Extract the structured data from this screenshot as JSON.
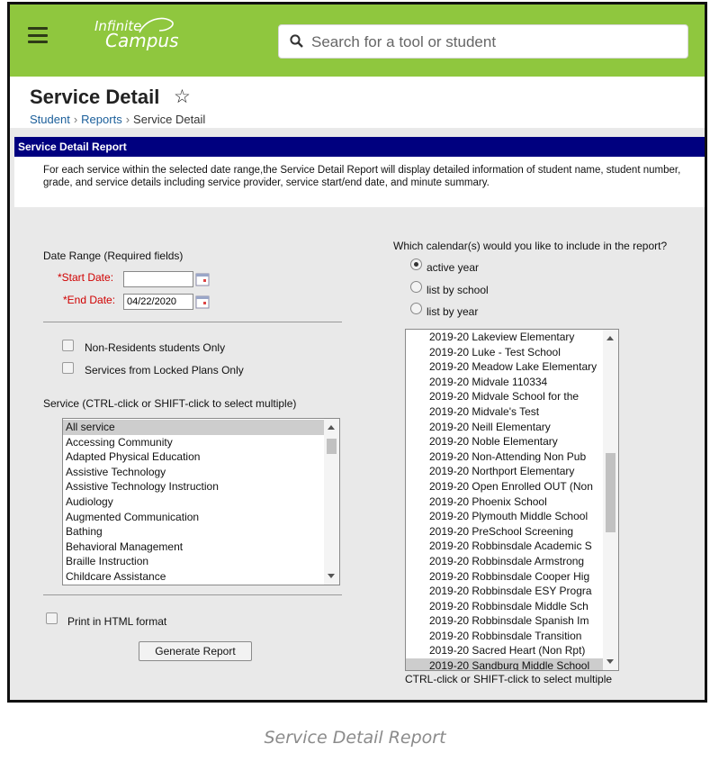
{
  "app": {
    "logo_line1": "Infinite",
    "logo_line2": "Campus"
  },
  "search": {
    "placeholder": "Search for a tool or student"
  },
  "page": {
    "title": "Service Detail"
  },
  "breadcrumb": [
    "Student",
    "Reports",
    "Service Detail"
  ],
  "report": {
    "title": "Service Detail Report",
    "description": "For each service within the selected date range,the Service Detail Report will display detailed information of student name, student number, grade, and service details including service provider, service start/end date, and minute summary."
  },
  "form": {
    "date_range_label": "Date Range (Required fields)",
    "start_date_label": "*Start Date:",
    "start_date_value": "",
    "end_date_label": "*End Date:",
    "end_date_value": "04/22/2020",
    "non_residents_label": "Non-Residents students Only",
    "locked_plans_label": "Services from Locked Plans Only",
    "service_label": "Service (CTRL-click or SHIFT-click to select multiple)",
    "services": [
      "All service",
      "Accessing Community",
      "Adapted Physical Education",
      "Assistive Technology",
      "Assistive Technology Instruction",
      "Audiology",
      "Augmented Communication",
      "Bathing",
      "Behavioral Management",
      "Braille Instruction",
      "Childcare Assistance"
    ],
    "selected_service": "All service",
    "print_html_label": "Print in HTML format",
    "generate_button": "Generate Report",
    "calendar_question": "Which calendar(s) would you like to include in the report?",
    "calendar_options": [
      "active year",
      "list by school",
      "list by year"
    ],
    "selected_calendar_option": "active year",
    "calendars": [
      "2019-20 Lakeview Elementary",
      "2019-20 Luke - Test School",
      "2019-20 Meadow Lake Elementary",
      "2019-20 Midvale 110334",
      "2019-20 Midvale School for the",
      "2019-20 Midvale's Test",
      "2019-20 Neill Elementary",
      "2019-20 Noble Elementary",
      "2019-20 Non-Attending Non Pub",
      "2019-20 Northport Elementary",
      "2019-20 Open Enrolled OUT (Non",
      "2019-20 Phoenix School",
      "2019-20 Plymouth Middle School",
      "2019-20 PreSchool Screening",
      "2019-20 Robbinsdale Academic S",
      "2019-20 Robbinsdale Armstrong",
      "2019-20 Robbinsdale Cooper Hig",
      "2019-20 Robbinsdale ESY Progra",
      "2019-20 Robbinsdale Middle Sch",
      "2019-20 Robbinsdale Spanish Im",
      "2019-20 Robbinsdale Transition",
      "2019-20 Sacred Heart (Non Rpt)",
      "2019-20 Sandburg Middle School"
    ],
    "selected_calendar": "2019-20 Sandburg Middle School",
    "calendar_hint": "CTRL-click or SHIFT-click to select multiple"
  },
  "caption": "Service Detail Report",
  "colors": {
    "topbar": "#8fc73e",
    "banner": "#00007f",
    "link": "#1a5e9a",
    "required": "#d00000"
  }
}
